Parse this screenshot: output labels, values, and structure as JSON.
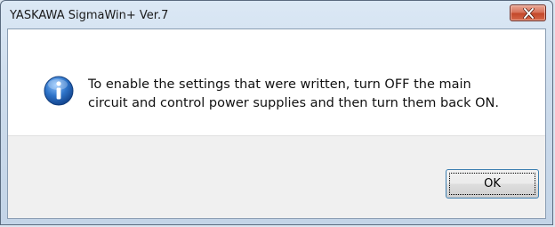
{
  "window": {
    "title": "YASKAWA SigmaWin+ Ver.7"
  },
  "icons": {
    "close": "close-icon",
    "message": "information-icon"
  },
  "message": {
    "line1": "To enable the settings that were written, turn OFF the main",
    "line2": "circuit and control power supplies and then turn them back ON."
  },
  "buttons": {
    "ok_label": "OK"
  },
  "colors": {
    "close_button": "#c4482a",
    "focus_border": "#3c7fb1",
    "info_icon": "#1f63b5"
  }
}
